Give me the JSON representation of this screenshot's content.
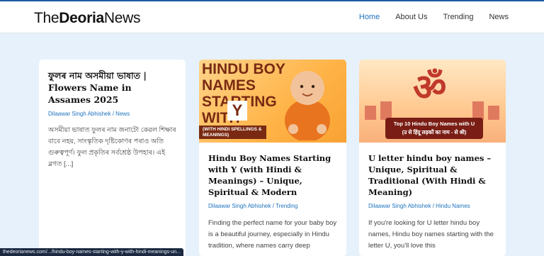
{
  "header": {
    "logo_the": "The",
    "logo_deoria": "Deoria",
    "logo_news": "News",
    "nav": [
      "Home",
      "About Us",
      "Trending",
      "News"
    ]
  },
  "posts": [
    {
      "title_line1": "ফুলৰ নাম অসমীয়া ভাষাত |",
      "title_line2": "Flowers Name in Assames 2025",
      "author": "Dilaawar Singh Abhishek",
      "category": "News",
      "excerpt": "অসমীয়া ভাষাত ফুলৰ নাম জনাটো কেৱল শিক্ষাৰ বাবে নহয়, সাংস্কৃতিক দৃষ্টিকোণৰ পৰাও অতি গুৰুত্বপূৰ্ণ। ফুল প্ৰকৃতিৰ সৰ্বশ্ৰেষ্ঠ উপহাৰ। এই ব্লগত [...]"
    },
    {
      "thumb_title": "HINDU BOY NAMES STARTING WITH",
      "thumb_letter": "Y",
      "thumb_ribbon": "(WITH HINDI SPELLINGS & MEANINGS)",
      "title": "Hindu Boy Names Starting with Y (with Hindi & Meanings) – Unique, Spiritual & Modern",
      "author": "Dilaawar Singh Abhishek",
      "category": "Trending",
      "excerpt": "Finding the perfect name for your baby boy is a beautiful journey, especially in Hindu tradition, where names carry deep"
    },
    {
      "thumb_title": "Top 10 Hindu Boy Names with U",
      "thumb_subtitle": "(उ से हिंदू लड़कों का नाम - से श्री)",
      "title": "U letter hindu boy names – Unique, Spiritual & Traditional (With Hindi & Meaning)",
      "author": "Dilaawar Singh Abhishek",
      "category": "Hindu Names",
      "excerpt": "If you're looking for U letter hindu boy names, Hindu boy names starting with the letter U, you'll love this"
    }
  ],
  "status_url": "thedeorianews.com/.../hindu-boy-names-starting-with-y-with-hindi-meanings-un..."
}
